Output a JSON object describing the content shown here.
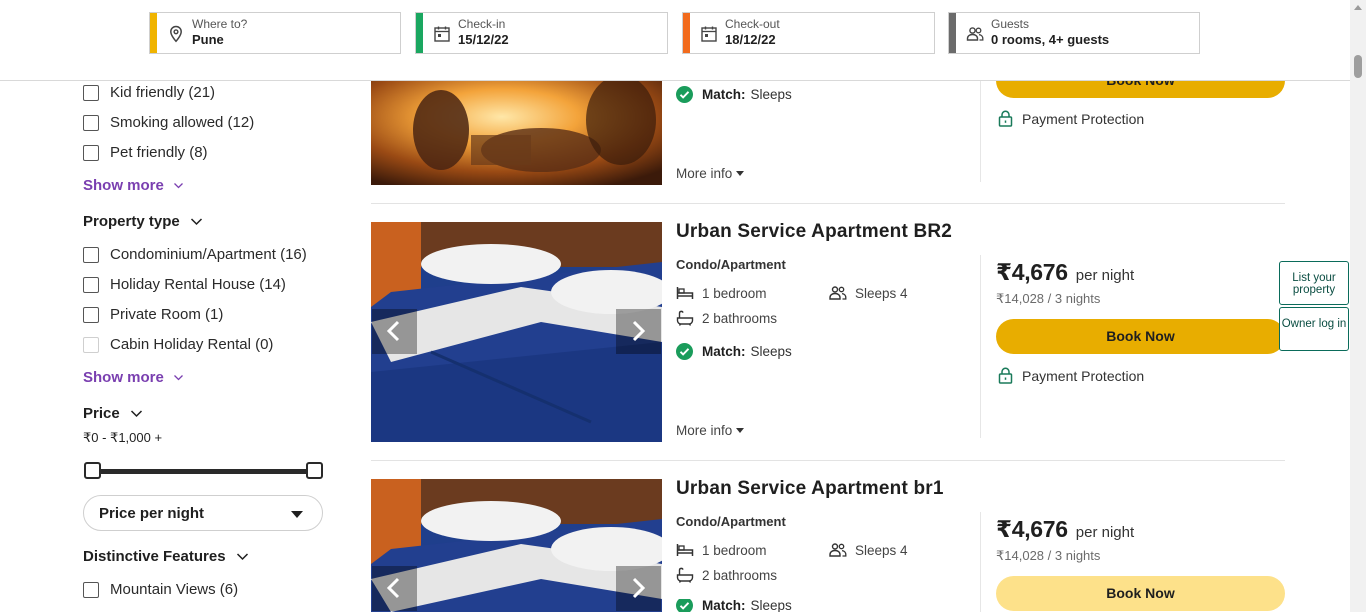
{
  "search": {
    "destination": {
      "label": "Where to?",
      "value": "Pune",
      "accent": "#f0b400",
      "icon": "location-pin-icon"
    },
    "checkin": {
      "label": "Check-in",
      "value": "15/12/22",
      "accent": "#1aa760",
      "icon": "calendar-icon"
    },
    "checkout": {
      "label": "Check-out",
      "value": "18/12/22",
      "accent": "#f26b1d",
      "icon": "calendar-icon"
    },
    "guests": {
      "label": "Guests",
      "value": "0 rooms, 4+ guests",
      "accent": "#6b6b6b",
      "icon": "people-icon"
    }
  },
  "filters": {
    "suitability": [
      {
        "label": "Kid friendly (21)"
      },
      {
        "label": "Smoking allowed (12)"
      },
      {
        "label": "Pet friendly (8)"
      }
    ],
    "show_more_1": "Show more",
    "property_type": {
      "title": "Property type",
      "options": [
        {
          "label": "Condominium/Apartment (16)",
          "disabled": false
        },
        {
          "label": "Holiday Rental House (14)",
          "disabled": false
        },
        {
          "label": "Private Room (1)",
          "disabled": false
        },
        {
          "label": "Cabin Holiday Rental (0)",
          "disabled": true
        }
      ]
    },
    "show_more_2": "Show more",
    "price": {
      "title": "Price",
      "range": "₹0 - ₹1,000 +",
      "slider_min": 0,
      "slider_max": 1,
      "select_value": "Price per night"
    },
    "distinctive": {
      "title": "Distinctive Features",
      "options": [
        {
          "label": "Mountain Views (6)"
        }
      ]
    }
  },
  "listings": [
    {
      "match_label": "Match:",
      "match_value": "Sleeps",
      "more_info": "More info",
      "book": "Book Now",
      "protection": "Payment Protection"
    },
    {
      "title": "Urban Service Apartment BR2",
      "type": "Condo/Apartment",
      "bedrooms": "1 bedroom",
      "bathrooms": "2 bathrooms",
      "sleeps": "Sleeps 4",
      "match_label": "Match:",
      "match_value": "Sleeps",
      "more_info": "More info",
      "price": "₹4,676",
      "per_night": "per night",
      "total": "₹14,028 / 3 nights",
      "book": "Book Now",
      "protection": "Payment Protection"
    },
    {
      "title": "Urban Service Apartment br1",
      "type": "Condo/Apartment",
      "bedrooms": "1 bedroom",
      "bathrooms": "2 bathrooms",
      "sleeps": "Sleeps 4",
      "match_label": "Match:",
      "match_value": "Sleeps",
      "price": "₹4,676",
      "per_night": "per night",
      "total": "₹14,028 / 3 nights",
      "book": "Book Now"
    }
  ],
  "side": {
    "list_property": "List your property",
    "owner_login": "Owner log in"
  },
  "colors": {
    "book_button": "#e8ad00",
    "link_purple": "#7a3fb0",
    "match_green": "#1a9c5b",
    "side_border": "#0a6b5a"
  }
}
